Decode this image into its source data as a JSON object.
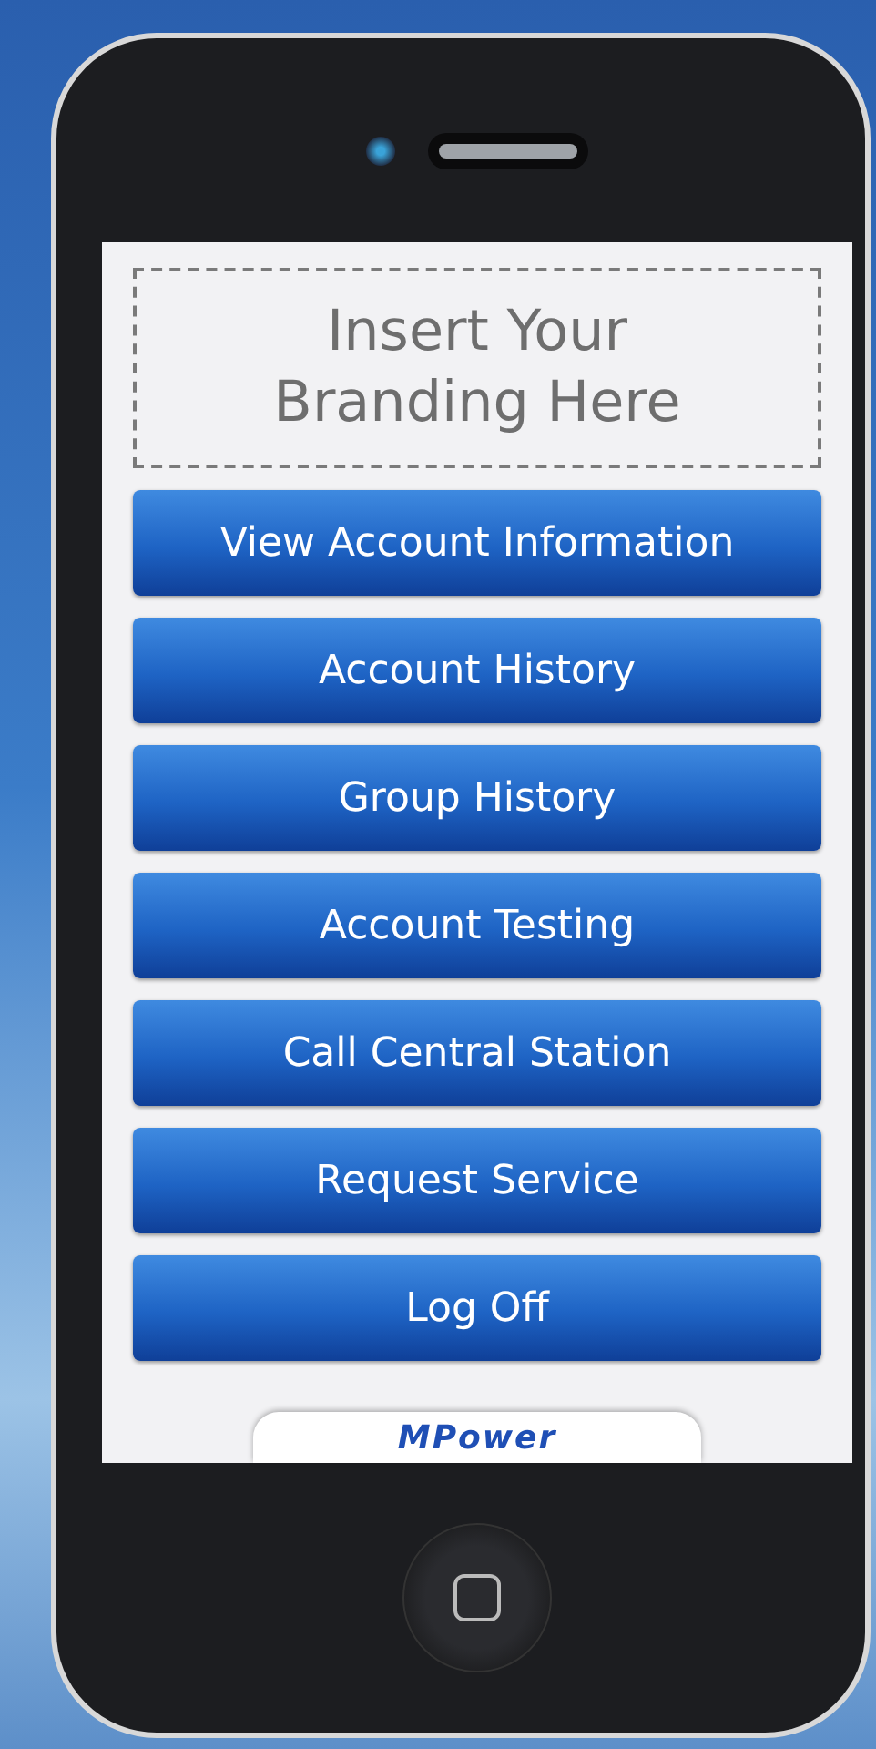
{
  "branding": {
    "text": "Insert Your Branding Here"
  },
  "menu": [
    {
      "label": "View Account Information"
    },
    {
      "label": "Account History"
    },
    {
      "label": "Group History"
    },
    {
      "label": "Account Testing"
    },
    {
      "label": "Call Central Station"
    },
    {
      "label": "Request Service"
    },
    {
      "label": "Log Off"
    }
  ],
  "footer": {
    "logo": "MPower"
  }
}
